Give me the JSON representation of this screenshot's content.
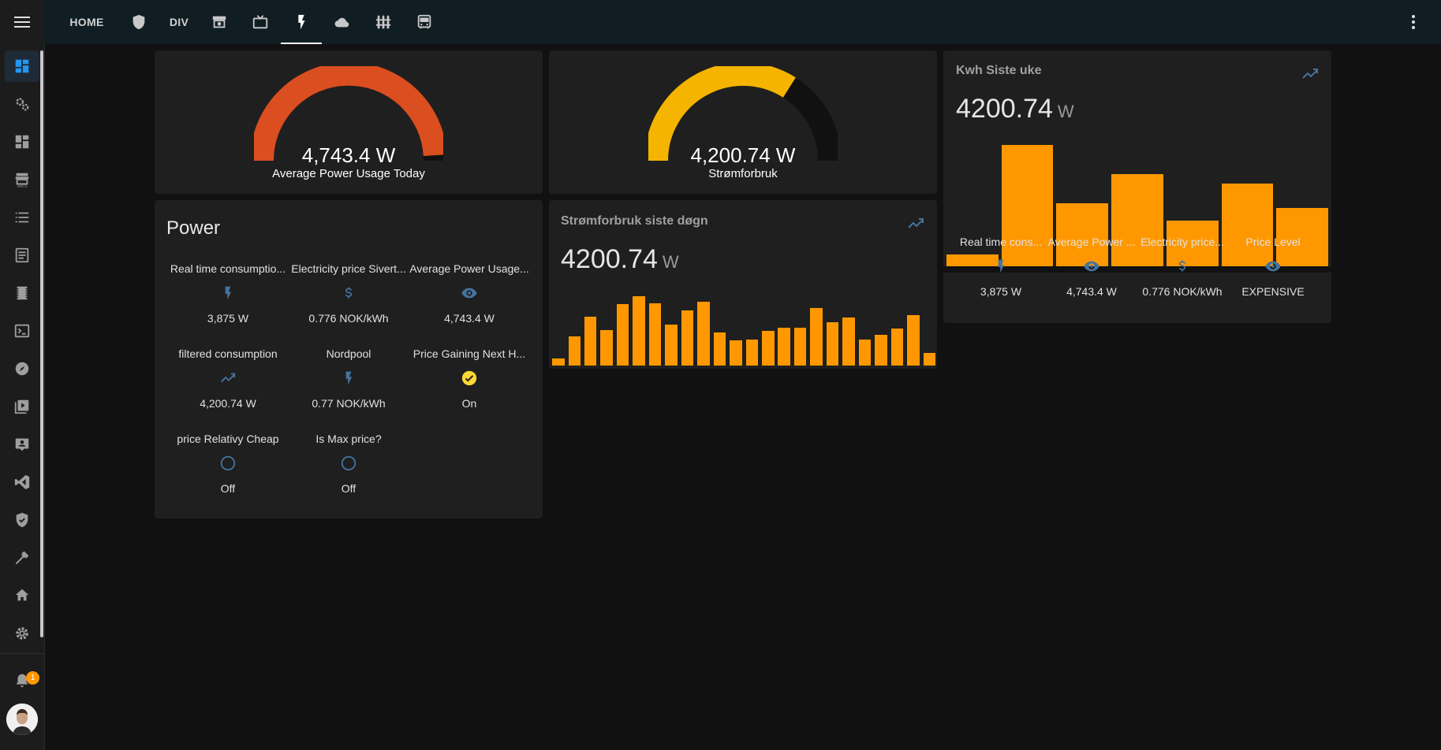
{
  "colors": {
    "accent": "#ff9800",
    "icon_blue": "#44739e",
    "gauge_red": "#db4e1f",
    "gauge_yellow": "#f4b400",
    "check_yellow": "#fdd835"
  },
  "sidebar": {
    "items": [
      "dashboard-icon",
      "cogs-icon",
      "view-dashboard-icon",
      "hacs-store-icon",
      "list-icon",
      "log-icon",
      "film-icon",
      "terminal-icon",
      "compass-icon",
      "media-icon",
      "badge-account-icon",
      "vscode-icon",
      "shield-check-icon",
      "hammer-icon",
      "home-wrench-icon",
      "settings-icon"
    ],
    "notifications_count": "1"
  },
  "header": {
    "tabs": [
      {
        "label": "HOME",
        "type": "text"
      },
      {
        "label": "",
        "type": "icon",
        "icon": "shield-icon"
      },
      {
        "label": "DIV",
        "type": "text"
      },
      {
        "label": "",
        "type": "icon",
        "icon": "robot-vacuum-icon"
      },
      {
        "label": "",
        "type": "icon",
        "icon": "tv-icon"
      },
      {
        "label": "",
        "type": "icon",
        "icon": "flash-icon",
        "active": true
      },
      {
        "label": "",
        "type": "icon",
        "icon": "cloud-icon"
      },
      {
        "label": "",
        "type": "icon",
        "icon": "fence-icon"
      },
      {
        "label": "",
        "type": "icon",
        "icon": "bus-icon"
      }
    ]
  },
  "gauge1": {
    "value": "4,743.4 W",
    "label": "Average Power Usage Today",
    "fraction": 0.98
  },
  "gauge2": {
    "value": "4,200.74 W",
    "label": "Strømforbruk",
    "fraction": 0.68
  },
  "power_card": {
    "title": "Power",
    "entities": [
      {
        "name": "Real time consumptio...",
        "icon": "flash-icon",
        "state": "3,875 W"
      },
      {
        "name": "Electricity price Sivert...",
        "icon": "currency-usd-icon",
        "state": "0.776 NOK/kWh"
      },
      {
        "name": "Average Power Usage...",
        "icon": "eye-icon",
        "state": "4,743.4 W"
      },
      {
        "name": "filtered consumption",
        "icon": "chart-line-icon",
        "state": "4,200.74 W"
      },
      {
        "name": "Nordpool",
        "icon": "flash-icon",
        "state": "0.77 NOK/kWh"
      },
      {
        "name": "Price Gaining Next H...",
        "icon": "check-circle-icon",
        "state": "On"
      },
      {
        "name": "price Relativy Cheap",
        "icon": "circle-outline-icon",
        "state": "Off"
      },
      {
        "name": "Is Max price?",
        "icon": "circle-outline-icon",
        "state": "Off"
      }
    ]
  },
  "day_card": {
    "title": "Strømforbruk siste døgn",
    "value": "4200.74",
    "unit": "W",
    "bars": [
      0.1,
      0.42,
      0.7,
      0.51,
      0.89,
      1.0,
      0.9,
      0.59,
      0.8,
      0.92,
      0.48,
      0.36,
      0.37,
      0.5,
      0.55,
      0.55,
      0.83,
      0.63,
      0.69,
      0.37,
      0.44,
      0.53,
      0.73,
      0.18
    ]
  },
  "week_card": {
    "title": "Kwh Siste uke",
    "value": "4200.74",
    "unit": "W",
    "bars": [
      0.1,
      1.0,
      0.52,
      0.76,
      0.38,
      0.68,
      0.48
    ],
    "entities": [
      {
        "name": "Real time cons...",
        "icon": "flash-icon",
        "state": "3,875 W"
      },
      {
        "name": "Average Power ...",
        "icon": "eye-icon",
        "state": "4,743.4 W"
      },
      {
        "name": "Electricity price...",
        "icon": "currency-usd-icon",
        "state": "0.776 NOK/kWh"
      },
      {
        "name": "Price Level",
        "icon": "eye-icon",
        "state": "EXPENSIVE"
      }
    ]
  }
}
